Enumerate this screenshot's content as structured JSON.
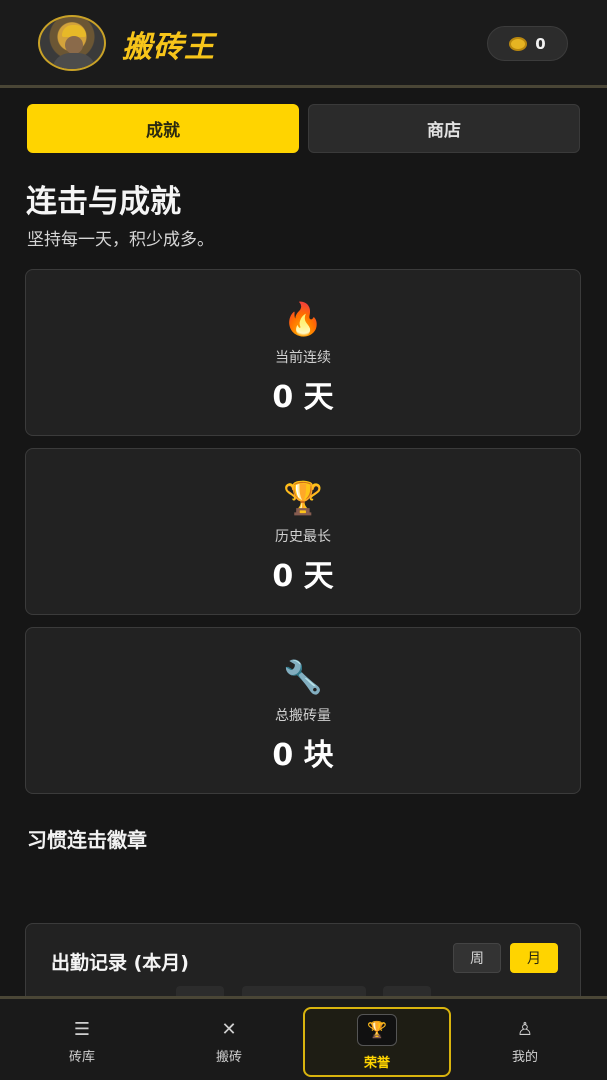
{
  "header": {
    "app_title": "搬砖王",
    "coin_count": "0",
    "coin_icon": "coin-icon",
    "avatar_icon": "miner-avatar"
  },
  "tabs": [
    {
      "label": "成就",
      "active": true
    },
    {
      "label": "商店",
      "active": false
    }
  ],
  "section": {
    "title": "连击与成就",
    "subtitle": "坚持每一天，积少成多。"
  },
  "stats": [
    {
      "icon": "fire-icon",
      "emoji": "🔥",
      "label": "当前连续",
      "value": "0 天"
    },
    {
      "icon": "trophy-icon",
      "emoji": "🏆",
      "label": "历史最长",
      "value": "0 天"
    },
    {
      "icon": "wrench-icon",
      "emoji": "🔧",
      "label": "总搬砖量",
      "value": "0 块"
    }
  ],
  "badges": {
    "title": "习惯连击徽章"
  },
  "attendance": {
    "title": "出勤记录 (本月)",
    "week_label": "周",
    "month_label": "月",
    "selected": "月"
  },
  "nav": [
    {
      "label": "砖库",
      "icon": "menu-icon",
      "active": false
    },
    {
      "label": "搬砖",
      "icon": "tools-icon",
      "active": false
    },
    {
      "label": "荣誉",
      "icon": "trophy-icon",
      "active": true
    },
    {
      "label": "我的",
      "icon": "user-icon",
      "active": false
    }
  ],
  "colors": {
    "accent": "#ffd400",
    "background": "#161616",
    "card": "#222222"
  }
}
